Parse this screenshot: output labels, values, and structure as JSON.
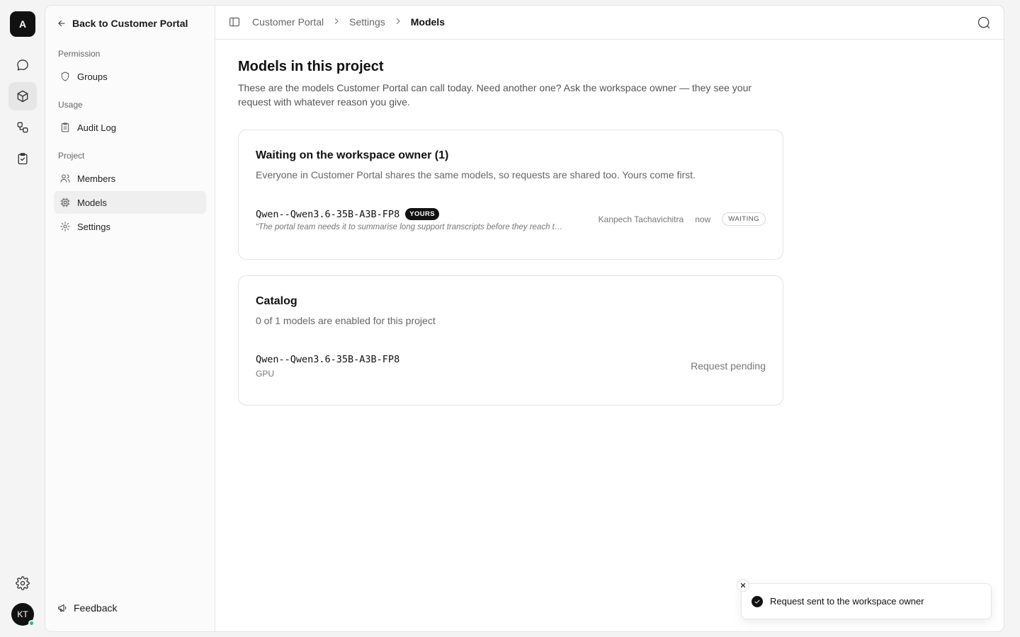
{
  "rail": {
    "logo_letter": "A",
    "avatar_initials": "KT",
    "icons": [
      "chat-icon",
      "cube-icon",
      "workflow-icon",
      "clipboard-check-icon",
      "gear-icon"
    ]
  },
  "sidebar": {
    "back_label": "Back to Customer Portal",
    "sections": {
      "permission": "Permission",
      "usage": "Usage",
      "project": "Project"
    },
    "items": {
      "groups": "Groups",
      "audit_log": "Audit Log",
      "members": "Members",
      "models": "Models",
      "settings": "Settings"
    },
    "active_item": "models",
    "feedback_label": "Feedback"
  },
  "breadcrumb": [
    "Customer Portal",
    "Settings",
    "Models"
  ],
  "page": {
    "title": "Models in this project",
    "description": "These are the models Customer Portal can call today. Need another one? Ask the workspace owner — they see your request with whatever reason you give."
  },
  "waiting_card": {
    "title": "Waiting on the workspace owner (1)",
    "subtitle": "Everyone in Customer Portal shares the same models, so requests are shared too. Yours come first.",
    "request": {
      "model": "Qwen--Qwen3.6-35B-A3B-FP8",
      "badge": "YOURS",
      "reason": "“The portal team needs it to summarise long support transcripts before they reach t…",
      "requester": "Kanpech Tachavichitra",
      "time": "now",
      "status": "WAITING"
    }
  },
  "catalog_card": {
    "title": "Catalog",
    "subtitle": "0 of 1 models are enabled for this project",
    "model": {
      "name": "Qwen--Qwen3.6-35B-A3B-FP8",
      "kind": "GPU",
      "status": "Request pending"
    }
  },
  "toast": {
    "message": "Request sent to the workspace owner"
  },
  "colors": {
    "accent": "#111111",
    "online": "#22c55e",
    "active_bg": "#efefef"
  }
}
